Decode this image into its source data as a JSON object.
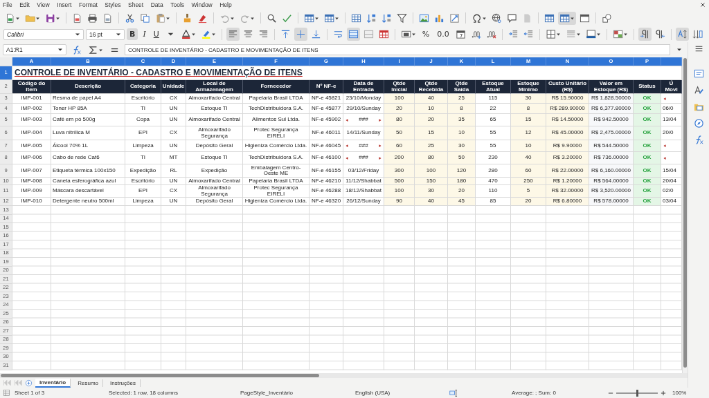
{
  "menu": [
    "File",
    "Edit",
    "View",
    "Insert",
    "Format",
    "Styles",
    "Sheet",
    "Data",
    "Tools",
    "Window",
    "Help"
  ],
  "toggles": {
    "split_window": true,
    "align_left": true,
    "align_center": false,
    "align_right": false,
    "valign_top": false,
    "valign_center": true,
    "valign_bottom": false,
    "merge_center": true,
    "left_to_right": true,
    "right_to_left": false,
    "vertical_text": true
  },
  "font_name": "Calibri",
  "font_size": "16 pt",
  "text_format_buttons": [
    {
      "label": "B",
      "active": true
    },
    {
      "label": "I",
      "active": false
    },
    {
      "label": "U",
      "active": false
    }
  ],
  "number_format_buttons": [
    "%",
    "0.0"
  ],
  "formula_bar": {
    "cell_reference": "A1:R1",
    "content": "CONTROLE DE INVENTÁRIO - CADASTRO E MOVIMENTAÇÃO DE ITENS"
  },
  "sheet": {
    "title": "CONTROLE DE INVENTÁRIO - CADASTRO E MOVIMENTAÇÃO DE ITENS",
    "title_row": "1",
    "header_row": "2",
    "columns": [
      {
        "letter": "A",
        "header": "Código do Item",
        "kind": "code"
      },
      {
        "letter": "B",
        "header": "Descrição",
        "kind": "description"
      },
      {
        "letter": "C",
        "header": "Categoria",
        "kind": "label"
      },
      {
        "letter": "D",
        "header": "Unidade",
        "kind": "label"
      },
      {
        "letter": "E",
        "header": "Local de Armazenagem",
        "kind": "label"
      },
      {
        "letter": "F",
        "header": "Fornecedor",
        "kind": "label"
      },
      {
        "letter": "G",
        "header": "Nº NF-e",
        "kind": "label"
      },
      {
        "letter": "H",
        "header": "Data de Entrada",
        "kind": "label"
      },
      {
        "letter": "I",
        "header": "Qtde Inicial",
        "kind": "input"
      },
      {
        "letter": "J",
        "header": "Qtde Recebida",
        "kind": "input"
      },
      {
        "letter": "K",
        "header": "Qtde Saída",
        "kind": "input"
      },
      {
        "letter": "L",
        "header": "Estoque Atual",
        "kind": "calc"
      },
      {
        "letter": "M",
        "header": "Estoque Mínimo",
        "kind": "input"
      },
      {
        "letter": "N",
        "header": "Custo Unitário (R$)",
        "kind": "input"
      },
      {
        "letter": "O",
        "header": "Valor em Estoque (R$)",
        "kind": "value"
      },
      {
        "letter": "P",
        "header": "Status",
        "kind": "status"
      }
    ],
    "column_q_header": "Ú Movi",
    "rows": [
      {
        "number": "3",
        "cells": [
          "IMP-001",
          "Resma de papel A4",
          "Escritório",
          "CX",
          "Almoxarifado Central",
          "Papelaria Brasil LTDA",
          "NF-e 45821",
          "23/10/Monday",
          "100",
          "40",
          "25",
          "115",
          "30",
          "R$ 15.90000",
          "R$ 1,828.50000",
          "OK"
        ],
        "date_overflow": false,
        "column_q_overflow": true
      },
      {
        "number": "4",
        "cells": [
          "IMP-002",
          "Toner HP 85A",
          "TI",
          "UN",
          "Estoque TI",
          "TechDistribuidora S.A.",
          "NF-e 45877",
          "29/10/Sunday",
          "20",
          "10",
          "8",
          "22",
          "8",
          "R$ 289.90000",
          "R$ 6,377.80000",
          "OK"
        ],
        "date_overflow": false,
        "column_q_overflow": false,
        "column_q": "06/0"
      },
      {
        "number": "5",
        "cells": [
          "IMP-003",
          "Café em pó 500g",
          "Copa",
          "UN",
          "Almoxarifado Central",
          "Alimentos Sul Ltda.",
          "NF-e 45902",
          "###",
          "80",
          "20",
          "35",
          "65",
          "15",
          "R$ 14.50000",
          "R$ 942.50000",
          "OK"
        ],
        "date_overflow": true,
        "column_q_overflow": false,
        "column_q": "13/04"
      },
      {
        "number": "6",
        "cells": [
          "IMP-004",
          "Luva nitrílica M",
          "EPI",
          "CX",
          "Almoxarifado Segurança",
          "Protec Segurança EIRELI",
          "NF-e 46011",
          "14/11/Sunday",
          "50",
          "15",
          "10",
          "55",
          "12",
          "R$ 45.00000",
          "R$ 2,475.00000",
          "OK"
        ],
        "date_overflow": false,
        "column_q_overflow": false,
        "column_q": "20/0"
      },
      {
        "number": "7",
        "cells": [
          "IMP-005",
          "Álcool 70% 1L",
          "Limpeza",
          "UN",
          "Depósito Geral",
          "Higieniza Comércio Ltda.",
          "NF-e 46045",
          "###",
          "60",
          "25",
          "30",
          "55",
          "10",
          "R$ 9.90000",
          "R$ 544.50000",
          "OK"
        ],
        "date_overflow": true,
        "column_q_overflow": true
      },
      {
        "number": "8",
        "cells": [
          "IMP-006",
          "Cabo de rede Cat6",
          "TI",
          "MT",
          "Estoque TI",
          "TechDistribuidora S.A.",
          "NF-e 46100",
          "###",
          "200",
          "80",
          "50",
          "230",
          "40",
          "R$ 3.20000",
          "R$ 736.00000",
          "OK"
        ],
        "date_overflow": true,
        "column_q_overflow": true
      },
      {
        "number": "9",
        "cells": [
          "IMP-007",
          "Etiqueta térmica 100x150",
          "Expedição",
          "RL",
          "Expedição",
          "Embalagem Centro-Oeste ME",
          "NF-e 46155",
          "03/12/Friday",
          "300",
          "100",
          "120",
          "280",
          "60",
          "R$ 22.00000",
          "R$ 6,160.00000",
          "OK"
        ],
        "date_overflow": false,
        "column_q_overflow": false,
        "column_q": "15/04"
      },
      {
        "number": "10",
        "cells": [
          "IMP-008",
          "Caneta esferográfica azul",
          "Escritório",
          "UN",
          "Almoxarifado Central",
          "Papelaria Brasil LTDA",
          "NF-e 46210",
          "11/12/Shabbat",
          "500",
          "150",
          "180",
          "470",
          "250",
          "R$ 1.20000",
          "R$ 564.00000",
          "OK"
        ],
        "date_overflow": false,
        "column_q_overflow": false,
        "column_q": "20/04"
      },
      {
        "number": "11",
        "cells": [
          "IMP-009",
          "Máscara descartável",
          "EPI",
          "CX",
          "Almoxarifado Segurança",
          "Protec Segurança EIRELI",
          "NF-e 46288",
          "18/12/Shabbat",
          "100",
          "30",
          "20",
          "110",
          "5",
          "R$ 32.00000",
          "R$ 3,520.00000",
          "OK"
        ],
        "date_overflow": false,
        "column_q_overflow": false,
        "column_q": "02/0"
      },
      {
        "number": "12",
        "cells": [
          "IMP-010",
          "Detergente neutro 500ml",
          "Limpeza",
          "UN",
          "Depósito Geral",
          "Higieniza Comércio Ltda.",
          "NF-e 46320",
          "26/12/Sunday",
          "90",
          "40",
          "45",
          "85",
          "20",
          "R$ 6.80000",
          "R$ 578.00000",
          "OK"
        ],
        "date_overflow": false,
        "column_q_overflow": false,
        "column_q": "03/04"
      }
    ],
    "empty_rows": [
      "13",
      "14",
      "15",
      "16",
      "17",
      "18",
      "19",
      "20",
      "21",
      "22",
      "23",
      "24",
      "25",
      "26",
      "27",
      "28",
      "29",
      "30",
      "31"
    ]
  },
  "sheet_tabs": [
    {
      "label": "Inventário",
      "selected": true
    },
    {
      "label": "Resumo",
      "selected": false
    },
    {
      "label": "Instruções",
      "selected": false
    }
  ],
  "status_bar": {
    "sheet": "Sheet 1 of 3",
    "selection": "Selected: 1 row, 18 columns",
    "page_style": "PageStyle_Inventário",
    "language": "English (USA)",
    "summary": "Average: ; Sum: 0",
    "zoom_slider": {
      "level": 0.5
    },
    "zoom": "100%"
  }
}
